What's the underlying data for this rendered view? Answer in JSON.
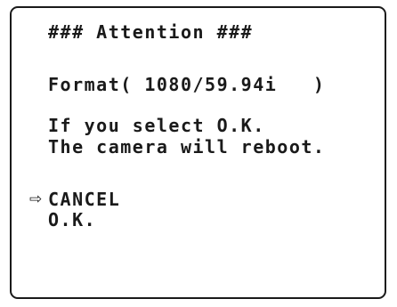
{
  "dialog": {
    "title": "### Attention ###",
    "format_line": "Format( 1080/59.94i   )",
    "message_line1": "If you select O.K.",
    "message_line2": "The camera will reboot."
  },
  "menu": {
    "cursor_glyph": "⇨",
    "items": [
      {
        "label": "CANCEL",
        "selected": true
      },
      {
        "label": "O.K.",
        "selected": false
      }
    ]
  }
}
